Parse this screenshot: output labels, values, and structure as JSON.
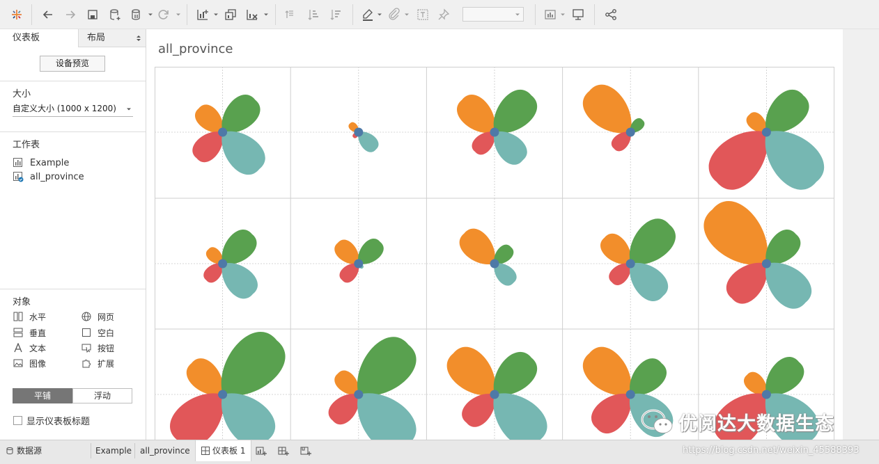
{
  "toolbar": {
    "icons": [
      "tableau-logo-icon",
      "undo-icon",
      "redo-icon",
      "save-icon",
      "new-datasource-icon",
      "pause-updates-icon",
      "refresh-icon",
      "new-worksheet-icon",
      "duplicate-icon",
      "clear-icon",
      "swap-icon",
      "sort-ascending-icon",
      "sort-descending-icon",
      "highlight-icon",
      "group-icon",
      "label-icon",
      "pin-icon",
      "show-me-icon",
      "presentation-icon",
      "share-icon"
    ],
    "fit_select_value": ""
  },
  "left_panel": {
    "tabs": {
      "dashboard": "仪表板",
      "layout": "布局"
    },
    "device_preview_label": "设备预览",
    "size": {
      "title": "大小",
      "value": "自定义大小 (1000 x 1200)"
    },
    "sheets": {
      "title": "工作表",
      "items": [
        "Example",
        "all_province"
      ]
    },
    "objects": {
      "title": "对象",
      "items": [
        {
          "label": "水平",
          "icon": "horizontal-icon"
        },
        {
          "label": "网页",
          "icon": "web-icon"
        },
        {
          "label": "垂直",
          "icon": "vertical-icon"
        },
        {
          "label": "空白",
          "icon": "blank-icon"
        },
        {
          "label": "文本",
          "icon": "text-icon"
        },
        {
          "label": "按钮",
          "icon": "button-icon"
        },
        {
          "label": "图像",
          "icon": "image-icon"
        },
        {
          "label": "扩展",
          "icon": "extension-icon"
        }
      ]
    },
    "layout_mode": {
      "tiled": "平铺",
      "floating": "浮动",
      "selected": "平铺"
    },
    "show_title_label": "显示仪表板标题",
    "show_title_checked": false
  },
  "dashboard": {
    "title": "all_province",
    "colors": {
      "orange": "#F28E2B",
      "green": "#59A14F",
      "red": "#E15759",
      "teal": "#76B7B2",
      "center": "#4E79A7"
    }
  },
  "chart_data": {
    "type": "other",
    "description_type": "small-multiples radial petal glyphs, 4 petals per cell (orange up-left, green up-right, red down-left, teal down-right)",
    "rows": 3,
    "cols": 5,
    "petal_order": [
      "orange",
      "green",
      "red",
      "teal"
    ],
    "cells": [
      {
        "values": [
          0.55,
          0.75,
          0.6,
          0.85
        ]
      },
      {
        "values": [
          0.2,
          0.07,
          0.12,
          0.4
        ]
      },
      {
        "values": [
          0.75,
          0.85,
          0.45,
          0.65
        ]
      },
      {
        "values": [
          0.95,
          0.28,
          0.38,
          0.05
        ]
      },
      {
        "values": [
          0.4,
          0.85,
          1.15,
          1.15
        ]
      },
      {
        "values": [
          0.33,
          0.68,
          0.38,
          0.7
        ]
      },
      {
        "values": [
          0.48,
          0.5,
          0.38,
          0.1
        ]
      },
      {
        "values": [
          0.7,
          0.38,
          0.0,
          0.44
        ]
      },
      {
        "values": [
          0.6,
          0.9,
          0.43,
          0.75
        ]
      },
      {
        "values": [
          1.25,
          0.68,
          0.8,
          0.9
        ]
      },
      {
        "values": [
          0.72,
          1.25,
          1.05,
          1.05
        ]
      },
      {
        "values": [
          0.48,
          1.15,
          0.6,
          1.15
        ]
      },
      {
        "values": [
          0.95,
          0.85,
          0.65,
          1.05
        ]
      },
      {
        "values": [
          0.95,
          0.72,
          0.78,
          0.85
        ]
      },
      {
        "values": [
          0.45,
          0.75,
          1.05,
          1.05
        ]
      }
    ]
  },
  "bottom_tabs": {
    "datasource": "数据源",
    "sheets": [
      "Example",
      "all_province"
    ],
    "active": "仪表板 1",
    "new_icons": [
      "new-worksheet-icon",
      "new-dashboard-icon",
      "new-story-icon"
    ]
  },
  "watermark": {
    "text": "优阅达大数据生态",
    "url": "https://blog.csdn.net/weixin_45588393"
  }
}
